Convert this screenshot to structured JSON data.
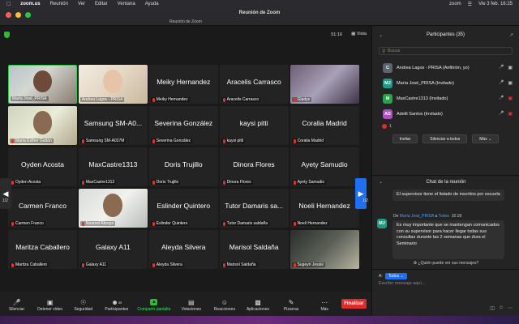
{
  "menubar": {
    "apple": "",
    "app": "zoom.us",
    "items": [
      "Reunión",
      "Ver",
      "Editar",
      "Ventana",
      "Ayuda"
    ],
    "status_app": "zoom",
    "datetime": "Vie 3 feb.  16:25"
  },
  "window": {
    "title": "Reunión de Zoom",
    "subtitle": "Reunión de Zoom"
  },
  "meeting": {
    "elapsed": "51:16",
    "view_label": "Vista",
    "page_left": "1/2",
    "page_right": "1/2"
  },
  "tiles": [
    {
      "name": "",
      "label": "María José_PRISA",
      "muted": false,
      "photo": "ph1",
      "active": true
    },
    {
      "name": "",
      "label": "Andrea Lagos - PRISA",
      "muted": false,
      "photo": "ph2",
      "active": false
    },
    {
      "name": "Meiky Hernandez",
      "label": "Meiky Hernandez",
      "muted": true
    },
    {
      "name": "Aracelis Carrasco",
      "label": "Aracelis Carrasco",
      "muted": true
    },
    {
      "name": "",
      "label": "Gladys",
      "muted": true,
      "photo": "ph3"
    },
    {
      "name": "",
      "label": "María Esther Gaitán",
      "muted": true,
      "photo": "ph4"
    },
    {
      "name": "Samsung SM-A0...",
      "label": "Samsung SM-A037M",
      "muted": true
    },
    {
      "name": "Severina González",
      "label": "Severina González",
      "muted": true
    },
    {
      "name": "kaysi pitti",
      "label": "kaysi pitti",
      "muted": true
    },
    {
      "name": "Coralia Madrid",
      "label": "Coralia Madrid",
      "muted": true
    },
    {
      "name": "Oyden Acosta",
      "label": "Oyden Acosta",
      "muted": true
    },
    {
      "name": "MaxCastre1313",
      "label": "MaxCastre1313",
      "muted": true
    },
    {
      "name": "Doris Trujillo",
      "label": "Doris Trujillo",
      "muted": true
    },
    {
      "name": "Dinora Flores",
      "label": "Dinora Flores",
      "muted": true
    },
    {
      "name": "Ayety  Samudio",
      "label": "Ayety  Samudio",
      "muted": true
    },
    {
      "name": "Carmen Franco",
      "label": "Carmen Franco",
      "muted": true
    },
    {
      "name": "",
      "label": "Noamel Abrego",
      "muted": true,
      "photo": "ph5"
    },
    {
      "name": "Eslinder Quintero",
      "label": "Eslinder Quintero",
      "muted": true
    },
    {
      "name": "Tutor Damaris sa...",
      "label": "Tutor Damaris saldaña",
      "muted": true
    },
    {
      "name": "Noeli Hernandez",
      "label": "Noeli Hernandez",
      "muted": true
    },
    {
      "name": "Maritza Caballero",
      "label": "Maritza Caballero",
      "muted": true
    },
    {
      "name": "Galaxy A11",
      "label": "Galaxy A11",
      "muted": true
    },
    {
      "name": "Aleyda Silvera",
      "label": "Aleyda Silvera",
      "muted": true
    },
    {
      "name": "Marisol Saldaña",
      "label": "Marisol Saldaña",
      "muted": true
    },
    {
      "name": "",
      "label": "Sugeyri Jessie",
      "muted": true,
      "photo": "ph6"
    }
  ],
  "toolbar": {
    "items": [
      {
        "icon": "mic-icon",
        "label": "Silenciar"
      },
      {
        "icon": "video-icon",
        "label": "Detener video"
      },
      {
        "icon": "security-icon",
        "label": "Seguridad"
      },
      {
        "icon": "participants-icon",
        "label": "Participantes"
      },
      {
        "icon": "share-screen-icon",
        "label": "Compartir pantalla"
      },
      {
        "icon": "polls-icon",
        "label": "Votaciones"
      },
      {
        "icon": "reactions-icon",
        "label": "Reacciones"
      },
      {
        "icon": "apps-icon",
        "label": "Aplicaciones"
      },
      {
        "icon": "whiteboard-icon",
        "label": "Pizarras"
      },
      {
        "icon": "more-icon",
        "label": "Más"
      }
    ],
    "participants_count": "35",
    "end_label": "Finalizar"
  },
  "participants_panel": {
    "title": "Participantes (35)",
    "search_placeholder": "Buscar",
    "rows": [
      {
        "initials": "C",
        "color": "#5a6572",
        "name": "Andrea Lagos - PRISA (Anfitrión, yo)",
        "muted": false
      },
      {
        "initials": "MJ",
        "color": "#1f9a83",
        "name": "María José_PRISA (Invitado)",
        "muted": false
      },
      {
        "initials": "M",
        "color": "#27a34a",
        "name": "MaxCastre1313 (Invitado)",
        "muted": true
      },
      {
        "initials": "AS",
        "color": "#b04fc4",
        "name": "Adelit Santos (Invitado)",
        "muted": true
      },
      {
        "initials": "AC",
        "color": "#c4404a",
        "name": "Aracelis Carrasco (Invitado)",
        "muted": true
      }
    ],
    "unmuted_count": "1",
    "invite_label": "Invitar",
    "mute_all_label": "Silenciar a todos",
    "more_label": "Más"
  },
  "chat_panel": {
    "title": "Chat de la reunión",
    "msg1": "El supervisor tiene el listado de inscritos por escuela",
    "meta_from": "De",
    "meta_sender": "María José_PRISA",
    "meta_to_word": "a",
    "meta_to": "Todos",
    "meta_time": "16:18",
    "sender_initials": "MJ",
    "msg2": "Es muy importante que se mantengan comunicados con su supervisor para hacer llegar todas sus consultas durante las 2 semanas que dura el Seminario",
    "private_question": "¿Quién puede ver sus mensajes?",
    "to_label": "A:",
    "to_value": "Todos",
    "input_placeholder": "Escribir mensaje aquí..."
  }
}
